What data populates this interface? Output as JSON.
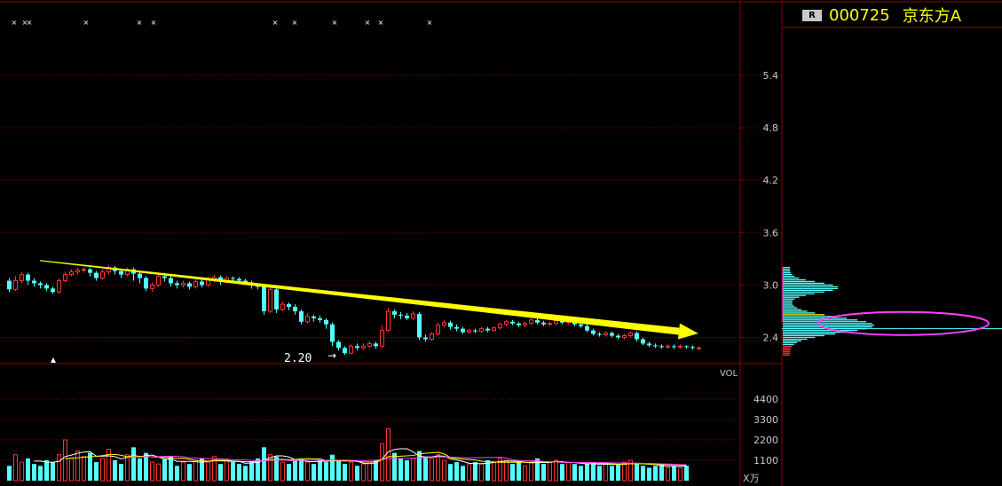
{
  "header": {
    "badge": "R",
    "code": "000725",
    "name": "京东方A"
  },
  "price_axis": {
    "ticks": [
      "5.4",
      "4.8",
      "4.2",
      "3.6",
      "3.0",
      "2.4"
    ]
  },
  "volume_axis": {
    "label": "VOL",
    "ticks": [
      "4400",
      "3300",
      "2200",
      "1100"
    ],
    "unit": "X万"
  },
  "annotation": {
    "low_label": "2.20"
  },
  "colors": {
    "up": "#ff3232",
    "down": "#54ffff",
    "grid": "#8b0000",
    "trend_arrow": "#ffff00",
    "highlight_ellipse": "#ff40ff"
  },
  "chart_data": {
    "type": "candlestick",
    "ylim": [
      2.1,
      6.0
    ],
    "trend": {
      "start": 3.28,
      "end": 2.47
    },
    "candles": [
      [
        3.05,
        2.95,
        3.08,
        2.92
      ],
      [
        2.95,
        3.05,
        3.1,
        2.93
      ],
      [
        3.05,
        3.12,
        3.15,
        3.02
      ],
      [
        3.12,
        3.05,
        3.14,
        3.0
      ],
      [
        3.05,
        3.02,
        3.08,
        2.98
      ],
      [
        3.02,
        3.0,
        3.04,
        2.96
      ],
      [
        3.0,
        2.96,
        3.02,
        2.93
      ],
      [
        2.96,
        2.92,
        2.98,
        2.9
      ],
      [
        2.92,
        3.05,
        3.08,
        2.9
      ],
      [
        3.05,
        3.12,
        3.15,
        3.03
      ],
      [
        3.12,
        3.15,
        3.18,
        3.1
      ],
      [
        3.15,
        3.17,
        3.2,
        3.12
      ],
      [
        3.17,
        3.18,
        3.21,
        3.14
      ],
      [
        3.18,
        3.14,
        3.2,
        3.1
      ],
      [
        3.14,
        3.08,
        3.16,
        3.05
      ],
      [
        3.08,
        3.15,
        3.18,
        3.06
      ],
      [
        3.15,
        3.2,
        3.23,
        3.12
      ],
      [
        3.2,
        3.16,
        3.22,
        3.12
      ],
      [
        3.16,
        3.12,
        3.18,
        3.08
      ],
      [
        3.12,
        3.18,
        3.2,
        3.1
      ],
      [
        3.18,
        3.13,
        3.2,
        3.05
      ],
      [
        3.13,
        3.08,
        3.15,
        3.02
      ],
      [
        3.08,
        2.96,
        3.1,
        2.93
      ],
      [
        2.96,
        3.0,
        3.03,
        2.92
      ],
      [
        3.0,
        3.1,
        3.13,
        2.98
      ],
      [
        3.1,
        3.08,
        3.14,
        3.04
      ],
      [
        3.08,
        3.02,
        3.1,
        2.98
      ],
      [
        3.02,
        3.0,
        3.05,
        2.96
      ],
      [
        3.0,
        3.02,
        3.05,
        2.97
      ],
      [
        3.02,
        2.98,
        3.04,
        2.95
      ],
      [
        2.98,
        3.04,
        3.06,
        2.96
      ],
      [
        3.04,
        3.0,
        3.06,
        2.97
      ],
      [
        3.0,
        3.06,
        3.09,
        2.98
      ],
      [
        3.06,
        3.09,
        3.12,
        3.03
      ],
      [
        3.09,
        3.04,
        3.11,
        3.0
      ],
      [
        3.04,
        3.08,
        3.1,
        3.02
      ],
      [
        3.08,
        3.07,
        3.1,
        3.04
      ],
      [
        3.07,
        3.05,
        3.09,
        3.02
      ],
      [
        3.05,
        3.03,
        3.07,
        3.0
      ],
      [
        3.03,
        3.0,
        3.05,
        2.96
      ],
      [
        3.0,
        2.98,
        3.02,
        2.95
      ],
      [
        2.98,
        2.7,
        3.0,
        2.66
      ],
      [
        2.7,
        2.95,
        2.98,
        2.68
      ],
      [
        2.95,
        2.72,
        2.97,
        2.68
      ],
      [
        2.72,
        2.78,
        2.81,
        2.7
      ],
      [
        2.78,
        2.75,
        2.8,
        2.71
      ],
      [
        2.75,
        2.7,
        2.78,
        2.66
      ],
      [
        2.7,
        2.58,
        2.72,
        2.55
      ],
      [
        2.58,
        2.64,
        2.68,
        2.56
      ],
      [
        2.64,
        2.62,
        2.66,
        2.58
      ],
      [
        2.62,
        2.6,
        2.65,
        2.57
      ],
      [
        2.6,
        2.55,
        2.62,
        2.5
      ],
      [
        2.55,
        2.35,
        2.57,
        2.3
      ],
      [
        2.35,
        2.28,
        2.37,
        2.25
      ],
      [
        2.28,
        2.22,
        2.3,
        2.2
      ],
      [
        2.22,
        2.3,
        2.32,
        2.21
      ],
      [
        2.3,
        2.28,
        2.33,
        2.25
      ],
      [
        2.28,
        2.3,
        2.33,
        2.26
      ],
      [
        2.3,
        2.33,
        2.36,
        2.28
      ],
      [
        2.33,
        2.3,
        2.35,
        2.27
      ],
      [
        2.3,
        2.48,
        2.54,
        2.28
      ],
      [
        2.48,
        2.7,
        2.74,
        2.46
      ],
      [
        2.7,
        2.66,
        2.72,
        2.62
      ],
      [
        2.66,
        2.65,
        2.69,
        2.61
      ],
      [
        2.65,
        2.62,
        2.68,
        2.6
      ],
      [
        2.62,
        2.67,
        2.7,
        2.6
      ],
      [
        2.67,
        2.4,
        2.69,
        2.37
      ],
      [
        2.4,
        2.38,
        2.43,
        2.35
      ],
      [
        2.38,
        2.44,
        2.46,
        2.36
      ],
      [
        2.44,
        2.54,
        2.57,
        2.42
      ],
      [
        2.54,
        2.57,
        2.6,
        2.52
      ],
      [
        2.57,
        2.52,
        2.59,
        2.49
      ],
      [
        2.52,
        2.5,
        2.55,
        2.47
      ],
      [
        2.5,
        2.46,
        2.52,
        2.44
      ],
      [
        2.46,
        2.48,
        2.5,
        2.44
      ],
      [
        2.48,
        2.47,
        2.5,
        2.45
      ],
      [
        2.47,
        2.5,
        2.52,
        2.45
      ],
      [
        2.5,
        2.48,
        2.52,
        2.46
      ],
      [
        2.48,
        2.51,
        2.53,
        2.47
      ],
      [
        2.51,
        2.55,
        2.57,
        2.49
      ],
      [
        2.55,
        2.58,
        2.6,
        2.53
      ],
      [
        2.58,
        2.56,
        2.6,
        2.54
      ],
      [
        2.56,
        2.54,
        2.58,
        2.52
      ],
      [
        2.54,
        2.56,
        2.58,
        2.52
      ],
      [
        2.56,
        2.6,
        2.62,
        2.54
      ],
      [
        2.6,
        2.57,
        2.62,
        2.55
      ],
      [
        2.57,
        2.55,
        2.59,
        2.53
      ],
      [
        2.55,
        2.56,
        2.58,
        2.53
      ],
      [
        2.56,
        2.59,
        2.61,
        2.54
      ],
      [
        2.59,
        2.57,
        2.61,
        2.55
      ],
      [
        2.57,
        2.58,
        2.6,
        2.55
      ],
      [
        2.58,
        2.55,
        2.6,
        2.53
      ],
      [
        2.55,
        2.53,
        2.57,
        2.51
      ],
      [
        2.53,
        2.48,
        2.55,
        2.46
      ],
      [
        2.48,
        2.44,
        2.5,
        2.42
      ],
      [
        2.44,
        2.43,
        2.46,
        2.41
      ],
      [
        2.43,
        2.45,
        2.47,
        2.41
      ],
      [
        2.45,
        2.42,
        2.47,
        2.4
      ],
      [
        2.42,
        2.4,
        2.44,
        2.38
      ],
      [
        2.4,
        2.42,
        2.44,
        2.38
      ],
      [
        2.42,
        2.45,
        2.47,
        2.4
      ],
      [
        2.45,
        2.38,
        2.47,
        2.35
      ],
      [
        2.38,
        2.33,
        2.4,
        2.31
      ],
      [
        2.33,
        2.31,
        2.35,
        2.29
      ],
      [
        2.31,
        2.3,
        2.33,
        2.28
      ],
      [
        2.3,
        2.29,
        2.32,
        2.27
      ],
      [
        2.29,
        2.3,
        2.32,
        2.27
      ],
      [
        2.3,
        2.29,
        2.32,
        2.27
      ],
      [
        2.29,
        2.3,
        2.32,
        2.27
      ],
      [
        2.3,
        2.29,
        2.31,
        2.27
      ],
      [
        2.29,
        2.28,
        2.31,
        2.26
      ],
      [
        2.28,
        2.28,
        2.3,
        2.26
      ]
    ],
    "volume": [
      8,
      14,
      10,
      12,
      9,
      8,
      11,
      10,
      14,
      22,
      12,
      16,
      13,
      15,
      10,
      12,
      17,
      11,
      9,
      14,
      18,
      12,
      15,
      10,
      9,
      12,
      13,
      8,
      10,
      9,
      11,
      12,
      10,
      13,
      9,
      11,
      10,
      9,
      8,
      10,
      12,
      18,
      14,
      13,
      10,
      9,
      11,
      12,
      10,
      9,
      11,
      10,
      14,
      11,
      9,
      10,
      8,
      9,
      10,
      11,
      20,
      28,
      15,
      12,
      11,
      12,
      16,
      13,
      12,
      14,
      11,
      9,
      10,
      8,
      9,
      10,
      9,
      11,
      10,
      12,
      11,
      9,
      10,
      8,
      10,
      12,
      9,
      10,
      11,
      9,
      10,
      9,
      8,
      9,
      10,
      8,
      9,
      8,
      9,
      10,
      11,
      9,
      8,
      7,
      8,
      9,
      7,
      8,
      7,
      8
    ],
    "volume_ylim": [
      0,
      5500
    ]
  }
}
